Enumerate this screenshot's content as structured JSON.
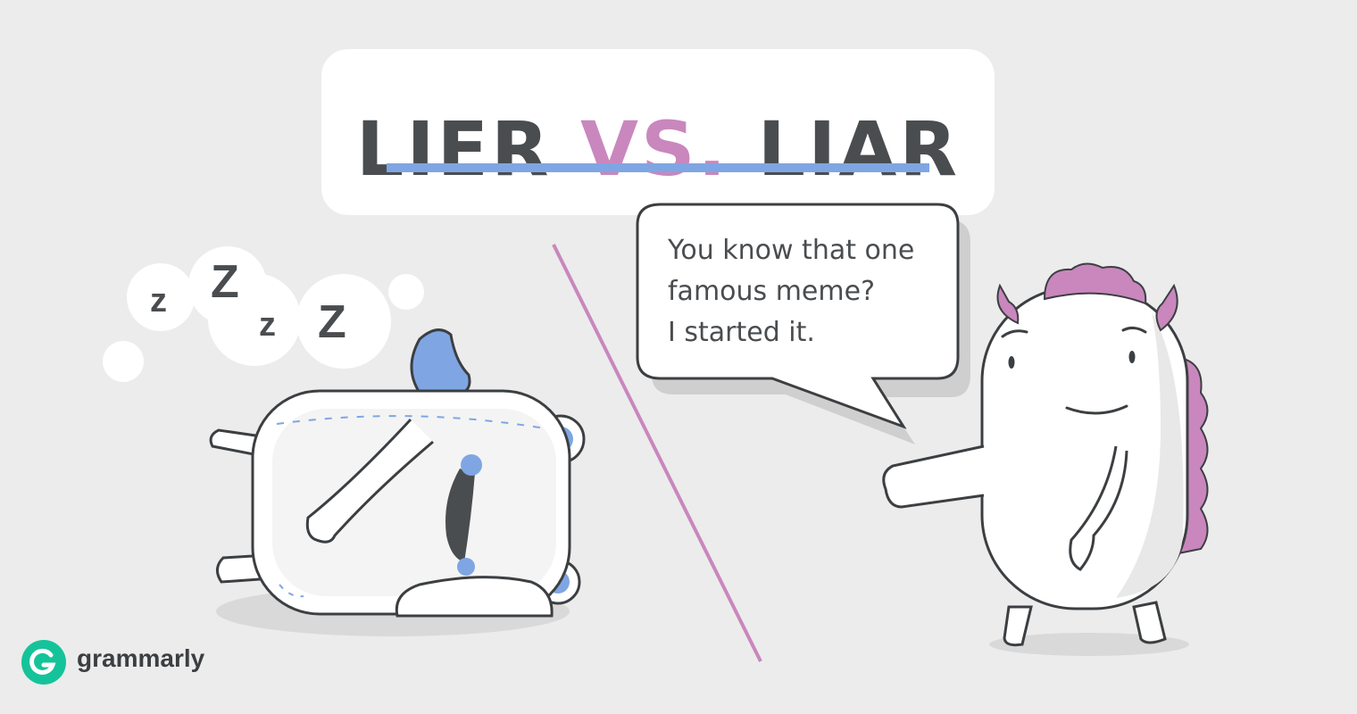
{
  "title": {
    "part1": "LIER",
    "part2": "VS.",
    "part3": "LIAR"
  },
  "speech_lines": [
    "You know that one",
    "famous meme?",
    "I started it."
  ],
  "sleep_letters": [
    "z",
    "Z",
    "z",
    "Z"
  ],
  "brand": {
    "name": "grammarly",
    "color": "#15c39a"
  },
  "colors": {
    "accent_pink": "#c987bd",
    "accent_blue": "#7fa6e3",
    "ink": "#4a4d50",
    "background": "#ececec"
  }
}
